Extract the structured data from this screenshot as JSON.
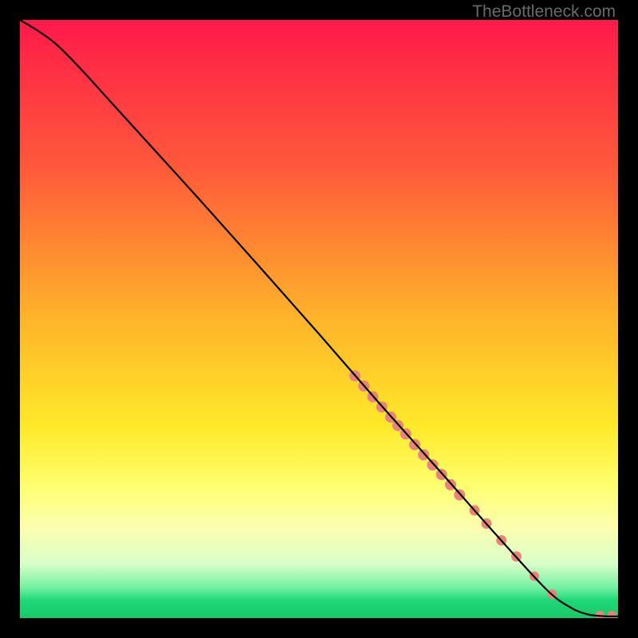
{
  "watermark": "TheBottleneck.com",
  "chart_data": {
    "type": "line",
    "title": "",
    "xlabel": "",
    "ylabel": "",
    "xlim": [
      0,
      100
    ],
    "ylim": [
      0,
      100
    ],
    "gradient_stops": [
      {
        "offset": 0,
        "color": "#ff1a4a"
      },
      {
        "offset": 25,
        "color": "#ff5a3a"
      },
      {
        "offset": 50,
        "color": "#ffb42a"
      },
      {
        "offset": 68,
        "color": "#ffe92a"
      },
      {
        "offset": 78,
        "color": "#ffff70"
      },
      {
        "offset": 85,
        "color": "#fbffb0"
      },
      {
        "offset": 91,
        "color": "#d8ffc8"
      },
      {
        "offset": 95,
        "color": "#70f0a0"
      },
      {
        "offset": 97,
        "color": "#20d878"
      },
      {
        "offset": 100,
        "color": "#18c868"
      }
    ],
    "curve": [
      {
        "x": 0,
        "y": 100
      },
      {
        "x": 3,
        "y": 98.2
      },
      {
        "x": 6,
        "y": 96
      },
      {
        "x": 10,
        "y": 92
      },
      {
        "x": 15,
        "y": 86.5
      },
      {
        "x": 20,
        "y": 81
      },
      {
        "x": 30,
        "y": 70
      },
      {
        "x": 40,
        "y": 58.8
      },
      {
        "x": 50,
        "y": 47.5
      },
      {
        "x": 60,
        "y": 36
      },
      {
        "x": 70,
        "y": 24.8
      },
      {
        "x": 80,
        "y": 13.5
      },
      {
        "x": 88,
        "y": 4.8
      },
      {
        "x": 92,
        "y": 1.8
      },
      {
        "x": 95,
        "y": 0.6
      },
      {
        "x": 98,
        "y": 0.3
      },
      {
        "x": 100,
        "y": 0.3
      }
    ],
    "scatter_points": [
      {
        "x": 56,
        "y": 40.5,
        "r": 7
      },
      {
        "x": 57.5,
        "y": 38.8,
        "r": 7
      },
      {
        "x": 59,
        "y": 37,
        "r": 7
      },
      {
        "x": 60.5,
        "y": 35.3,
        "r": 7
      },
      {
        "x": 62,
        "y": 33.6,
        "r": 7
      },
      {
        "x": 63.2,
        "y": 32.2,
        "r": 7
      },
      {
        "x": 64.5,
        "y": 30.8,
        "r": 7
      },
      {
        "x": 66,
        "y": 29,
        "r": 7
      },
      {
        "x": 67.5,
        "y": 27.3,
        "r": 7
      },
      {
        "x": 69,
        "y": 25.6,
        "r": 7
      },
      {
        "x": 70.5,
        "y": 24,
        "r": 7
      },
      {
        "x": 72,
        "y": 22.3,
        "r": 7
      },
      {
        "x": 73.5,
        "y": 20.6,
        "r": 7
      },
      {
        "x": 76,
        "y": 18,
        "r": 6.5
      },
      {
        "x": 78,
        "y": 15.8,
        "r": 6.5
      },
      {
        "x": 80.5,
        "y": 13,
        "r": 6.5
      },
      {
        "x": 83,
        "y": 10.3,
        "r": 6.5
      },
      {
        "x": 86,
        "y": 7,
        "r": 6
      },
      {
        "x": 89,
        "y": 4,
        "r": 6
      },
      {
        "x": 97,
        "y": 0.4,
        "r": 6
      },
      {
        "x": 99,
        "y": 0.4,
        "r": 6
      }
    ],
    "scatter_color": "#e88478"
  }
}
